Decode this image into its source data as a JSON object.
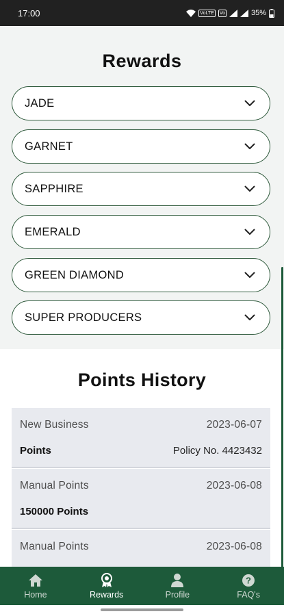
{
  "status_bar": {
    "time": "17:00",
    "battery": "35%"
  },
  "rewards": {
    "title": "Rewards",
    "tiers": [
      {
        "label": "JADE"
      },
      {
        "label": "GARNET"
      },
      {
        "label": "SAPPHIRE"
      },
      {
        "label": "EMERALD"
      },
      {
        "label": "GREEN DIAMOND"
      },
      {
        "label": "SUPER PRODUCERS"
      }
    ]
  },
  "points_history": {
    "title": "Points History",
    "entries": [
      {
        "type": "New Business",
        "date": "2023-06-07",
        "points": "Points",
        "policy": "Policy No. 4423432"
      },
      {
        "type": "Manual Points",
        "date": "2023-06-08",
        "points": "150000 Points",
        "policy": ""
      },
      {
        "type": "Manual Points",
        "date": "2023-06-08",
        "points": "",
        "policy": ""
      }
    ]
  },
  "bottom_nav": {
    "items": [
      {
        "label": "Home",
        "icon": "home-icon"
      },
      {
        "label": "Rewards",
        "icon": "rewards-icon",
        "active": true
      },
      {
        "label": "Profile",
        "icon": "profile-icon"
      },
      {
        "label": "FAQ's",
        "icon": "help-icon"
      }
    ]
  },
  "colors": {
    "accent": "#1d5a3a",
    "border": "#2f5a3c",
    "card": "#e8eaef"
  }
}
